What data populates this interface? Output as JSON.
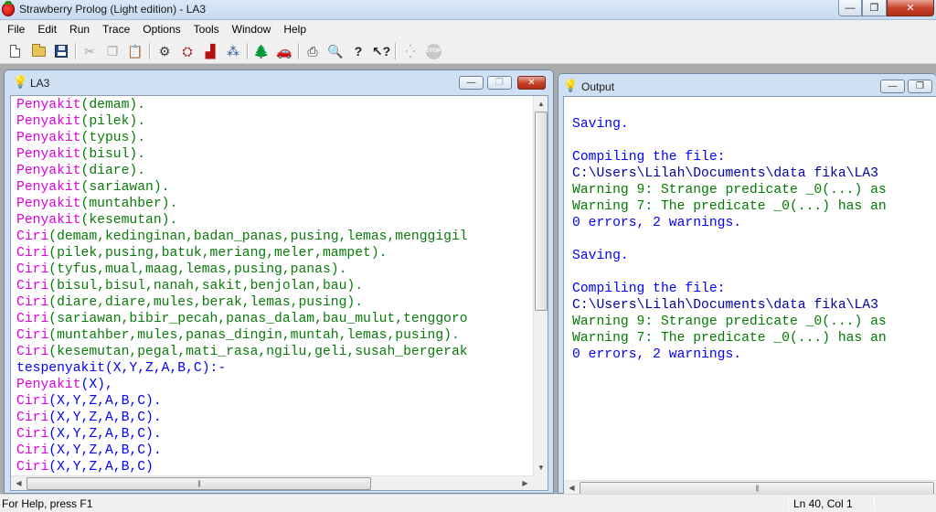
{
  "window": {
    "title": "Strawberry Prolog (Light edition) - LA3",
    "minimize": "—",
    "restore": "❐",
    "close": "✕"
  },
  "menu": [
    "File",
    "Edit",
    "Run",
    "Trace",
    "Options",
    "Tools",
    "Window",
    "Help"
  ],
  "toolbar": {
    "icons": [
      "new-document",
      "open-folder",
      "save-disk",
      "cut-scissors",
      "copy",
      "paste",
      "run",
      "trace",
      "stop-trace",
      "step",
      "tree",
      "car",
      "print",
      "print-preview",
      "help",
      "context-help",
      "debug",
      "stop"
    ]
  },
  "editor": {
    "title": "LA3",
    "lines": [
      [
        {
          "t": "Penyakit",
          "c": "mag"
        },
        {
          "t": "(demam).",
          "c": "grn"
        }
      ],
      [
        {
          "t": "Penyakit",
          "c": "mag"
        },
        {
          "t": "(pilek).",
          "c": "grn"
        }
      ],
      [
        {
          "t": "Penyakit",
          "c": "mag"
        },
        {
          "t": "(typus).",
          "c": "grn"
        }
      ],
      [
        {
          "t": "Penyakit",
          "c": "mag"
        },
        {
          "t": "(bisul).",
          "c": "grn"
        }
      ],
      [
        {
          "t": "Penyakit",
          "c": "mag"
        },
        {
          "t": "(diare).",
          "c": "grn"
        }
      ],
      [
        {
          "t": "Penyakit",
          "c": "mag"
        },
        {
          "t": "(sariawan).",
          "c": "grn"
        }
      ],
      [
        {
          "t": "Penyakit",
          "c": "mag"
        },
        {
          "t": "(muntahber).",
          "c": "grn"
        }
      ],
      [
        {
          "t": "Penyakit",
          "c": "mag"
        },
        {
          "t": "(kesemutan).",
          "c": "grn"
        }
      ],
      [
        {
          "t": "Ciri",
          "c": "mag"
        },
        {
          "t": "(demam,kedinginan,badan_panas,pusing,lemas,menggigil",
          "c": "grn"
        }
      ],
      [
        {
          "t": "Ciri",
          "c": "mag"
        },
        {
          "t": "(pilek,pusing,batuk,meriang,meler,mampet).",
          "c": "grn"
        }
      ],
      [
        {
          "t": "Ciri",
          "c": "mag"
        },
        {
          "t": "(tyfus,mual,maag,lemas,pusing,panas).",
          "c": "grn"
        }
      ],
      [
        {
          "t": "Ciri",
          "c": "mag"
        },
        {
          "t": "(bisul,bisul,nanah,sakit,benjolan,bau).",
          "c": "grn"
        }
      ],
      [
        {
          "t": "Ciri",
          "c": "mag"
        },
        {
          "t": "(diare,diare,mules,berak,lemas,pusing).",
          "c": "grn"
        }
      ],
      [
        {
          "t": "Ciri",
          "c": "mag"
        },
        {
          "t": "(sariawan,bibir_pecah,panas_dalam,bau_mulut,tenggoro",
          "c": "grn"
        }
      ],
      [
        {
          "t": "Ciri",
          "c": "mag"
        },
        {
          "t": "(muntahber,mules,panas_dingin,muntah,lemas,pusing).",
          "c": "grn"
        }
      ],
      [
        {
          "t": "Ciri",
          "c": "mag"
        },
        {
          "t": "(kesemutan,pegal,mati_rasa,ngilu,geli,susah_bergerak",
          "c": "grn"
        }
      ],
      [
        {
          "t": "tespenyakit(X,Y,Z,A,B,C):-",
          "c": "blu"
        }
      ],
      [
        {
          "t": "Penyakit",
          "c": "mag"
        },
        {
          "t": "(X),",
          "c": "blu"
        }
      ],
      [
        {
          "t": "Ciri",
          "c": "mag"
        },
        {
          "t": "(X,Y,Z,A,B,C).",
          "c": "blu"
        }
      ],
      [
        {
          "t": "Ciri",
          "c": "mag"
        },
        {
          "t": "(X,Y,Z,A,B,C).",
          "c": "blu"
        }
      ],
      [
        {
          "t": "Ciri",
          "c": "mag"
        },
        {
          "t": "(X,Y,Z,A,B,C).",
          "c": "blu"
        }
      ],
      [
        {
          "t": "Ciri",
          "c": "mag"
        },
        {
          "t": "(X,Y,Z,A,B,C).",
          "c": "blu"
        }
      ],
      [
        {
          "t": "Ciri",
          "c": "mag"
        },
        {
          "t": "(X,Y,Z,A,B,C)",
          "c": "blu"
        }
      ]
    ]
  },
  "output": {
    "title": "Output",
    "lines": [
      {
        "t": "Saving.",
        "c": "out-blue"
      },
      {
        "t": "",
        "c": "out-blue"
      },
      {
        "t": "Compiling the file:",
        "c": "out-blue"
      },
      {
        "t": "C:\\Users\\Lilah\\Documents\\data fika\\LA3",
        "c": "out-dblue"
      },
      {
        "t": "Warning 9: Strange predicate _0(...) as",
        "c": "out-green"
      },
      {
        "t": "Warning 7: The predicate _0(...) has an",
        "c": "out-green"
      },
      {
        "t": "0 errors, 2 warnings.",
        "c": "out-blue"
      },
      {
        "t": "",
        "c": "out-blue"
      },
      {
        "t": "Saving.",
        "c": "out-blue"
      },
      {
        "t": "",
        "c": "out-blue"
      },
      {
        "t": "Compiling the file:",
        "c": "out-blue"
      },
      {
        "t": "C:\\Users\\Lilah\\Documents\\data fika\\LA3",
        "c": "out-dblue"
      },
      {
        "t": "Warning 9: Strange predicate _0(...) as",
        "c": "out-green"
      },
      {
        "t": "Warning 7: The predicate _0(...) has an",
        "c": "out-green"
      },
      {
        "t": "0 errors, 2 warnings.",
        "c": "out-blue"
      }
    ]
  },
  "status": {
    "help": "For Help, press F1",
    "position": "Ln 40, Col 1"
  },
  "colors": {
    "keyword": "#e000e0",
    "args": "#0a7a0a",
    "rule": "#0000ff",
    "output_text": "#0000ff",
    "output_warning": "#007b00"
  }
}
